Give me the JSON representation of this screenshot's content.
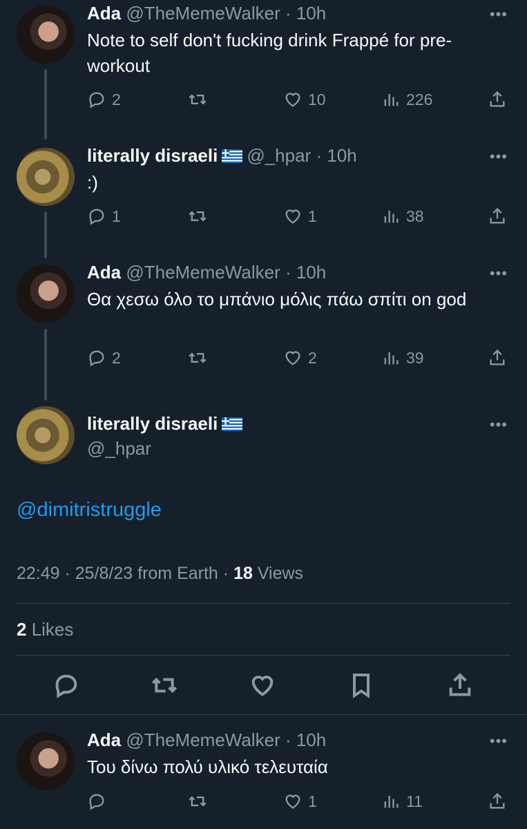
{
  "tweets": [
    {
      "name": "Ada",
      "handle": "@TheMemeWalker · 10h",
      "text": "Note to self don't fucking drink Frappé for pre-workout",
      "replies": "2",
      "retweets": "",
      "likes": "10",
      "views": "226"
    },
    {
      "name": "literally disraeli",
      "handle": "@_hpar · 10h",
      "text": ":)",
      "replies": "1",
      "retweets": "",
      "likes": "1",
      "views": "38"
    },
    {
      "name": "Ada",
      "handle": "@TheMemeWalker · 10h",
      "text": "Θα χεσω όλο το μπάνιο μόλις πάω σπίτι on god",
      "replies": "2",
      "retweets": "",
      "likes": "2",
      "views": "39"
    }
  ],
  "main": {
    "name": "literally disraeli",
    "handle": "@_hpar",
    "mention": "@dimitristruggle",
    "meta_prefix": "22:49 · 25/8/23 from Earth · ",
    "views_count": "18",
    "views_label": " Views",
    "likes_count": "2",
    "likes_label": " Likes"
  },
  "reply": {
    "name": "Ada",
    "handle": "@TheMemeWalker · 10h",
    "text": "Του δίνω πολύ υλικό τελευταία",
    "replies": "",
    "retweets": "",
    "likes": "1",
    "views": "11"
  },
  "colors": {
    "background": "#15202b",
    "text": "#f7f9f9",
    "muted": "#8b98a5",
    "link": "#1d9bf0",
    "flag_blue": "#0d5eaf"
  }
}
